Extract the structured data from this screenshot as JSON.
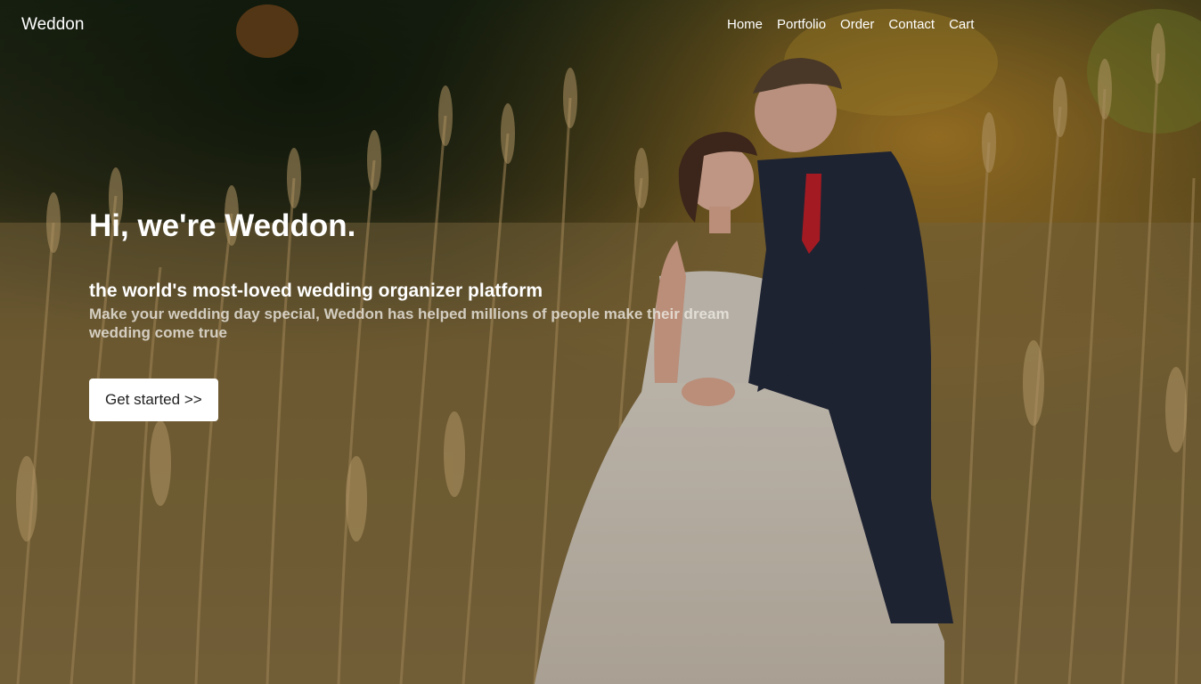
{
  "navbar": {
    "brand": "Weddon",
    "links": [
      "Home",
      "Portfolio",
      "Order",
      "Contact",
      "Cart"
    ]
  },
  "hero": {
    "title": "Hi, we're Weddon.",
    "subtitle": "the world's most-loved wedding organizer platform",
    "description": "Make your wedding day special, Weddon has helped millions of people make their dream wedding come true",
    "cta_label": "Get started >>"
  },
  "colors": {
    "text": "#ffffff",
    "button_bg": "#ffffff",
    "button_text": "#222222"
  }
}
